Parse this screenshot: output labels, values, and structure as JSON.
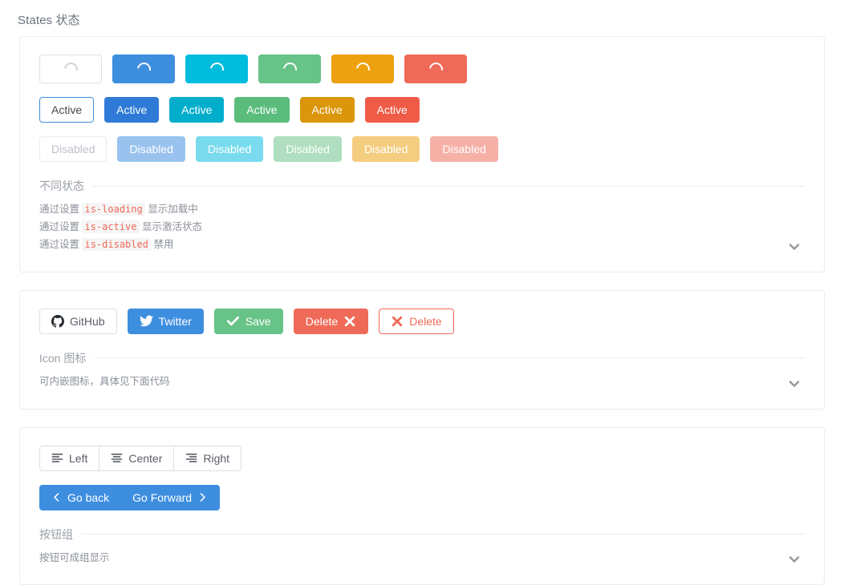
{
  "page": {
    "title": "States 状态"
  },
  "colors": {
    "default_border": "#dcdfe6",
    "primary": "#3e8ee0",
    "info": "#00bcdd",
    "success": "#67c387",
    "warning": "#eda10e",
    "danger": "#ef6a58",
    "code_text": "#ef6a58",
    "muted_text": "#9aa0a8"
  },
  "cards": [
    {
      "name": "states",
      "loading_row": {
        "label": "loading-buttons",
        "buttons": [
          {
            "variant": "default",
            "icon": "spinner-icon"
          },
          {
            "variant": "primary",
            "icon": "spinner-icon"
          },
          {
            "variant": "info",
            "icon": "spinner-icon"
          },
          {
            "variant": "success",
            "icon": "spinner-icon"
          },
          {
            "variant": "warning",
            "icon": "spinner-icon"
          },
          {
            "variant": "danger",
            "icon": "spinner-icon"
          }
        ]
      },
      "active_row": {
        "buttons": [
          {
            "variant": "default",
            "label": "Active"
          },
          {
            "variant": "primary",
            "label": "Active"
          },
          {
            "variant": "info",
            "label": "Active"
          },
          {
            "variant": "success",
            "label": "Active"
          },
          {
            "variant": "warning",
            "label": "Active"
          },
          {
            "variant": "danger",
            "label": "Active"
          }
        ]
      },
      "disabled_row": {
        "buttons": [
          {
            "variant": "default",
            "label": "Disabled"
          },
          {
            "variant": "primary",
            "label": "Disabled"
          },
          {
            "variant": "info",
            "label": "Disabled"
          },
          {
            "variant": "success",
            "label": "Disabled"
          },
          {
            "variant": "warning",
            "label": "Disabled"
          },
          {
            "variant": "danger",
            "label": "Disabled"
          }
        ]
      },
      "legend": "不同状态",
      "notes": [
        {
          "prefix": "通过设置 ",
          "code": "is-loading",
          "suffix": " 显示加载中"
        },
        {
          "prefix": "通过设置 ",
          "code": "is-active",
          "suffix": " 显示激活状态"
        },
        {
          "prefix": "通过设置 ",
          "code": "is-disabled",
          "suffix": " 禁用"
        }
      ],
      "expander_icon": "chevron-down-icon"
    },
    {
      "name": "icon",
      "buttons": [
        {
          "variant": "default",
          "label": "GitHub",
          "icon": "github-icon",
          "icon_position": "before"
        },
        {
          "variant": "primary",
          "label": "Twitter",
          "icon": "twitter-icon",
          "icon_position": "before"
        },
        {
          "variant": "success",
          "label": "Save",
          "icon": "check-icon",
          "icon_position": "before"
        },
        {
          "variant": "danger",
          "label": "Delete",
          "icon": "close-icon",
          "icon_position": "after"
        },
        {
          "variant": "outline-danger",
          "label": "Delete",
          "icon": "close-icon",
          "icon_position": "before"
        }
      ],
      "legend": "Icon 图标",
      "note": "可内嵌图标，具体见下面代码",
      "expander_icon": "chevron-down-icon"
    },
    {
      "name": "button-group",
      "align_group": [
        {
          "variant": "default",
          "label": "Left",
          "icon": "align-left-icon"
        },
        {
          "variant": "default",
          "label": "Center",
          "icon": "align-center-icon"
        },
        {
          "variant": "default",
          "label": "Right",
          "icon": "align-right-icon"
        }
      ],
      "nav_group": [
        {
          "variant": "primary",
          "label": "Go back",
          "icon": "chevron-left-icon",
          "icon_position": "before"
        },
        {
          "variant": "primary",
          "label": "Go Forward",
          "icon": "chevron-right-icon",
          "icon_position": "after"
        }
      ],
      "legend": "按钮组",
      "note": "按钮可成组显示",
      "expander_icon": "chevron-down-icon"
    }
  ]
}
